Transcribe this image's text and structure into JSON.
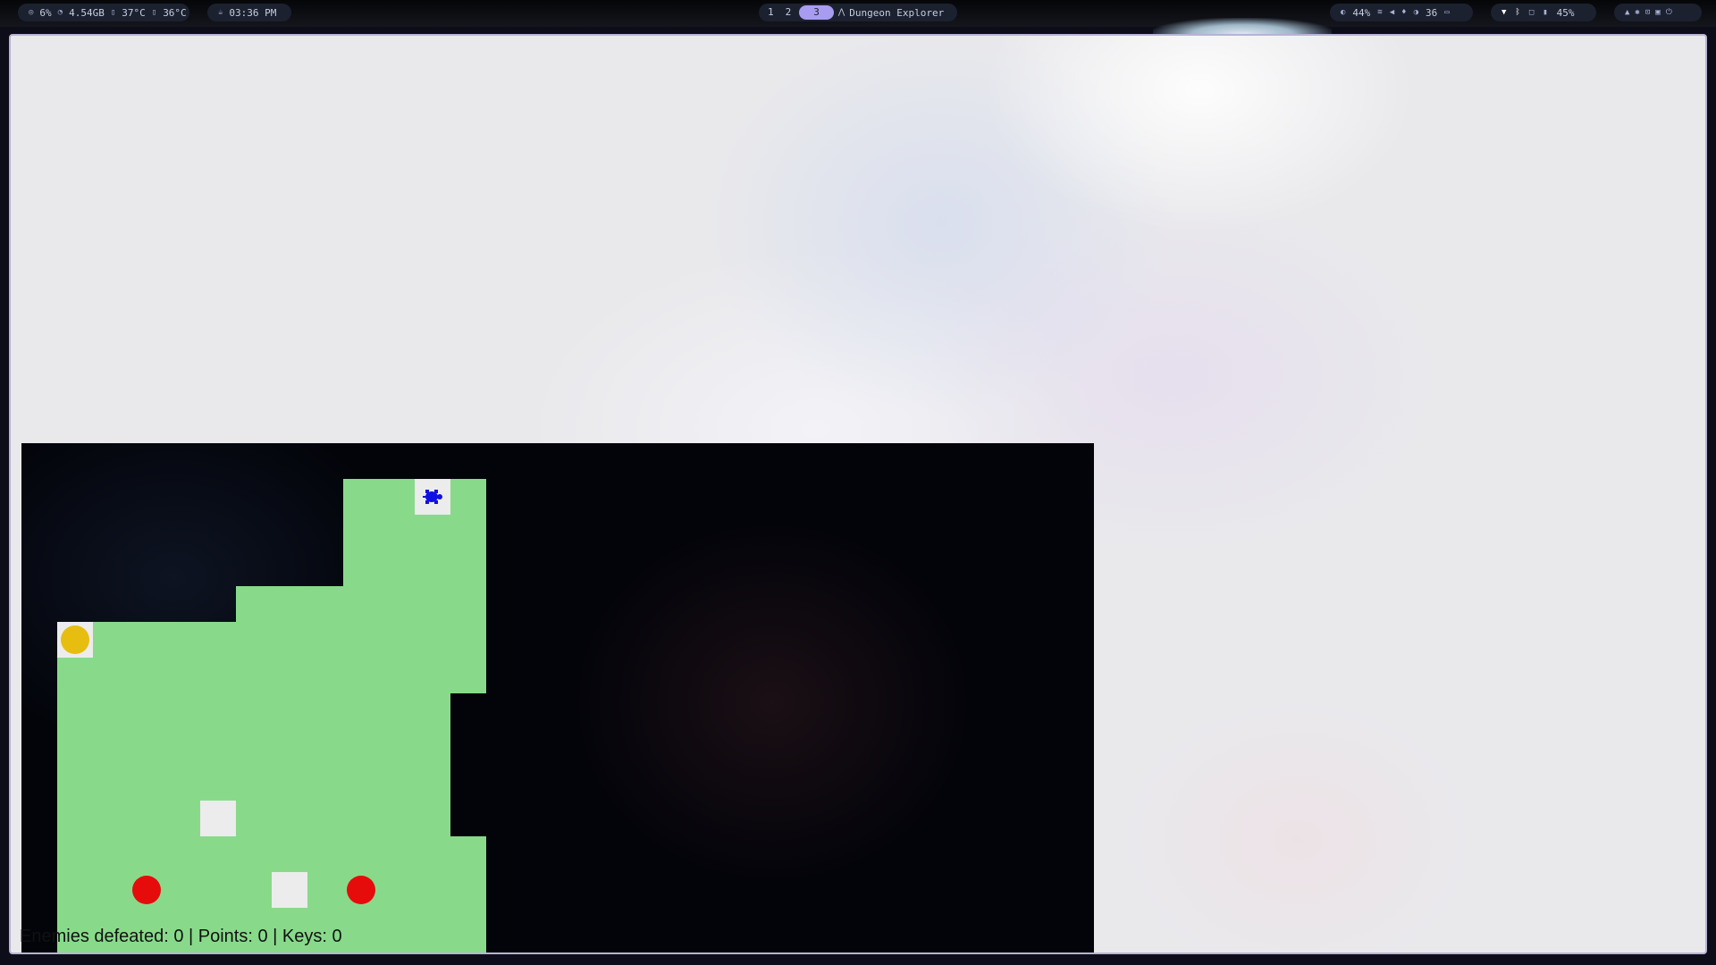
{
  "statusbar": {
    "system": {
      "cpu": "6%",
      "memory": "4.54GB",
      "temp1": "37°C",
      "temp2": "36°C"
    },
    "clock": "03:36 PM",
    "workspaces": [
      "1",
      "2",
      "3"
    ],
    "active_workspace": "3",
    "active_window_title": "Dungeon Explorer",
    "indicators": {
      "brightness": "44%",
      "volume_level": "36"
    },
    "battery": "45%"
  },
  "game": {
    "hud_text": "Enemies defeated: 0 | Points: 0 | Keys: 0",
    "colors": {
      "floor": "#88da8a",
      "wall": "#03040a",
      "tile": "#ececec",
      "coin": "#e7bd10",
      "enemy": "#e60c0c",
      "player": "#1010e0"
    }
  },
  "icons": {
    "cpu": "cpu-icon",
    "memory": "memory-icon",
    "temperature": "thermometer-icon",
    "clock": "clock-icon",
    "app": "app-launcher-icon",
    "brightness": "brightness-icon",
    "wifi": "wifi-icon",
    "volume": "volume-icon",
    "microphone": "mic-icon",
    "night": "moon-icon",
    "keyboard": "keyboard-icon",
    "bluetooth": "bluetooth-icon",
    "battery": "battery-icon",
    "player": "player-turtle-icon"
  }
}
